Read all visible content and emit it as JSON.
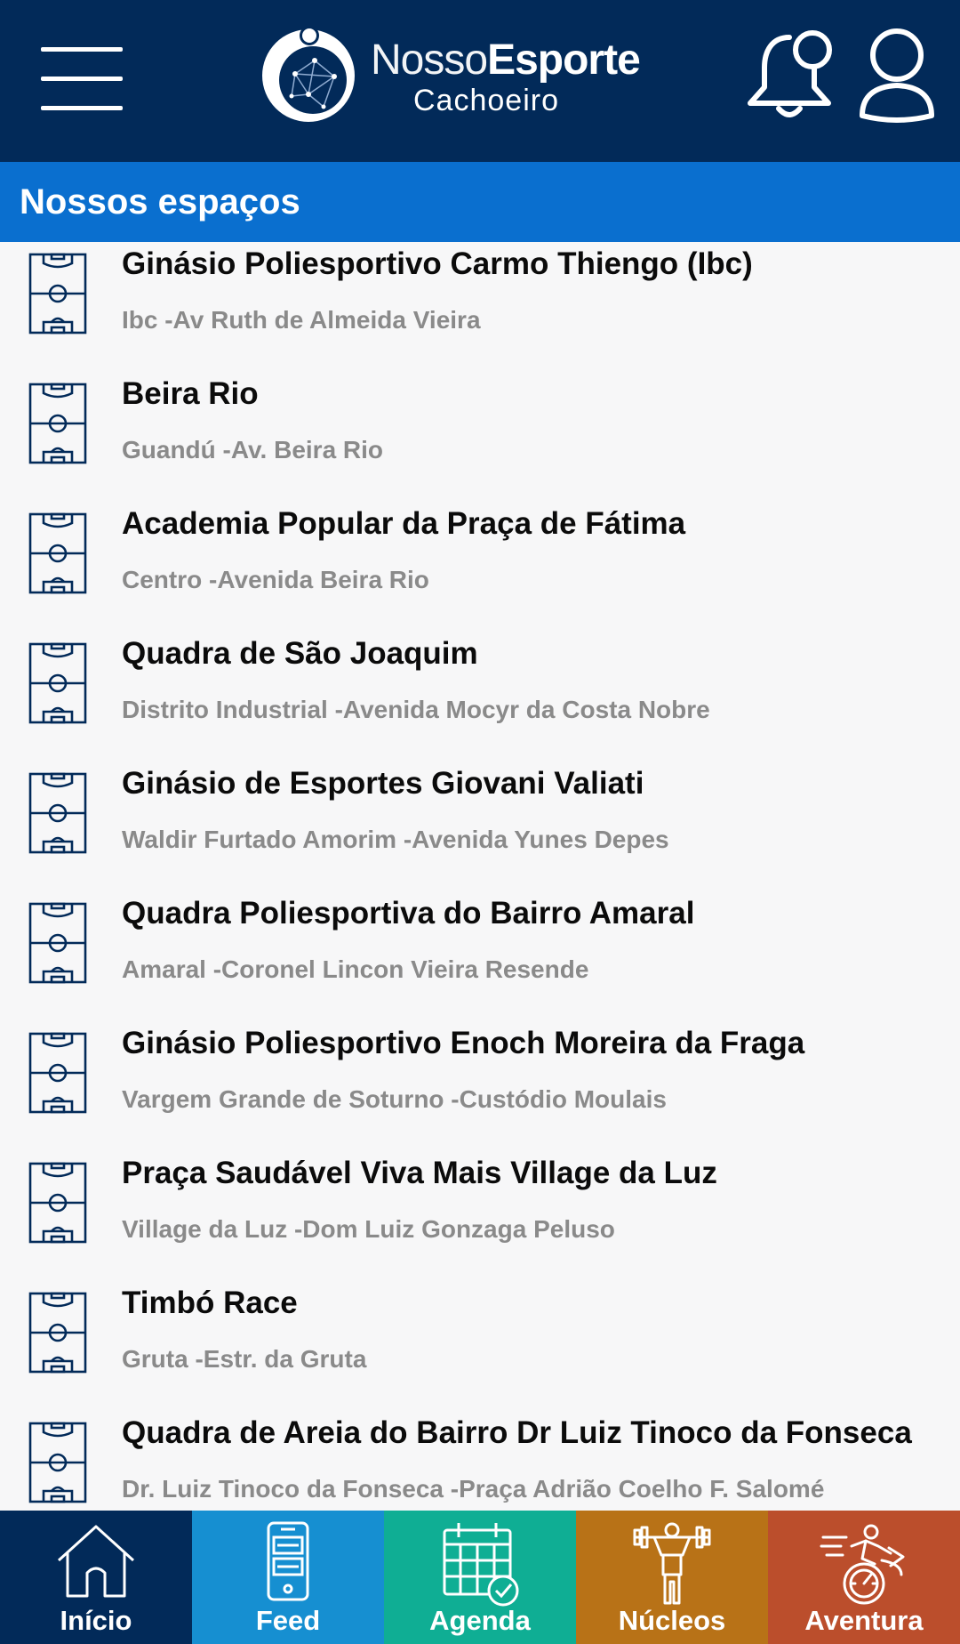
{
  "header": {
    "logo_line1_thin": "Nosso",
    "logo_line1_bold": "Esporte",
    "logo_line2": "Cachoeiro"
  },
  "section": {
    "title": "Nossos espaços"
  },
  "venues": [
    {
      "name": "Ginásio Poliesportivo Carmo Thiengo (Ibc)",
      "address": "Ibc -Av Ruth de Almeida Vieira"
    },
    {
      "name": "Beira Rio",
      "address": "Guandú -Av. Beira Rio"
    },
    {
      "name": "Academia Popular da Praça de Fátima",
      "address": "Centro -Avenida Beira Rio"
    },
    {
      "name": "Quadra de São Joaquim",
      "address": "Distrito Industrial -Avenida Mocyr da Costa Nobre"
    },
    {
      "name": "Ginásio de Esportes Giovani Valiati",
      "address": "Waldir Furtado Amorim -Avenida Yunes Depes"
    },
    {
      "name": "Quadra Poliesportiva do Bairro Amaral",
      "address": "Amaral -Coronel Lincon Vieira Resende"
    },
    {
      "name": "Ginásio Poliesportivo Enoch Moreira da Fraga",
      "address": "Vargem Grande de Soturno -Custódio Moulais"
    },
    {
      "name": "Praça Saudável Viva Mais Village da Luz",
      "address": "Village da Luz -Dom Luiz Gonzaga Peluso"
    },
    {
      "name": "Timbó Race",
      "address": "Gruta -Estr. da Gruta"
    },
    {
      "name": "Quadra de Areia do Bairro Dr Luiz Tinoco da Fonseca",
      "address": "Dr. Luiz Tinoco da Fonseca -Praça Adrião Coelho F. Salomé"
    }
  ],
  "nav": [
    {
      "label": "Início",
      "icon": "house-icon",
      "color": "#022a59"
    },
    {
      "label": "Feed",
      "icon": "phone-feed-icon",
      "color": "#168fd1"
    },
    {
      "label": "Agenda",
      "icon": "calendar-check-icon",
      "color": "#0fae94"
    },
    {
      "label": "Núcleos",
      "icon": "weightlifter-icon",
      "color": "#b87217"
    },
    {
      "label": "Aventura",
      "icon": "adventure-icon",
      "color": "#bb4e2c"
    }
  ],
  "colors": {
    "header_bg": "#022a59",
    "section_bar": "#0a6fcf",
    "list_bg": "#f7f7f8",
    "icon_stroke": "#022a59"
  }
}
